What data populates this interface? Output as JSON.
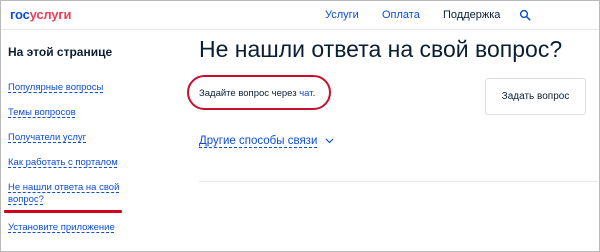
{
  "header": {
    "logo_part1": "гос",
    "logo_part2": "услуги",
    "nav": [
      {
        "label": "Услуги"
      },
      {
        "label": "Оплата"
      },
      {
        "label": "Поддержка"
      }
    ],
    "search_icon": "search-icon"
  },
  "sidebar": {
    "title": "На этой странице",
    "items": [
      {
        "label": "Популярные вопросы"
      },
      {
        "label": "Темы вопросов"
      },
      {
        "label": "Получатели услуг"
      },
      {
        "label": "Как работать с порталом"
      },
      {
        "label": "Не нашли ответа на свой вопрос?"
      },
      {
        "label": "Установите приложение"
      }
    ],
    "highlight_color": "#d0021b"
  },
  "main": {
    "title": "Не нашли ответа на свой вопрос?",
    "ask_prefix": "Задайте вопрос через",
    "chat_link": "чат",
    "ask_suffix": ".",
    "ask_button": "Задать вопрос",
    "other_ways": "Другие способы связи",
    "chevron_icon": "chevron-down-icon",
    "highlight_color": "#c8102e"
  },
  "colors": {
    "link": "#0d4cd3",
    "text": "#0b1f33",
    "logo_red": "#ee3f58"
  }
}
